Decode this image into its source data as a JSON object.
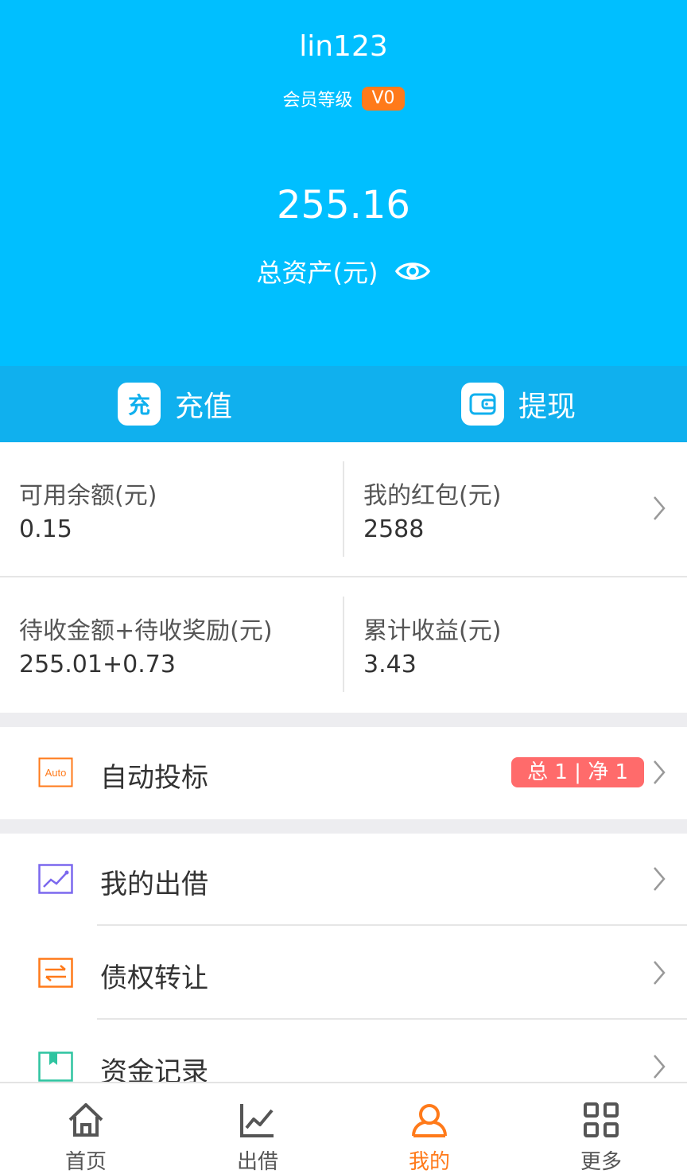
{
  "header": {
    "username": "lin123",
    "member_level_label": "会员等级",
    "member_level_badge": "V0",
    "total_assets": "255.16",
    "total_assets_label": "总资产(元)"
  },
  "actions": {
    "recharge_icon_text": "充",
    "recharge_label": "充值",
    "withdraw_label": "提现"
  },
  "stats": {
    "available_balance_label": "可用余额(元)",
    "available_balance_value": "0.15",
    "red_packet_label": "我的红包(元)",
    "red_packet_value": "2588",
    "pending_label": "待收金额+待收奖励(元)",
    "pending_value": "255.01+0.73",
    "cumulative_label": "累计收益(元)",
    "cumulative_value": "3.43"
  },
  "menu": {
    "auto_bid_icon_text": "Auto",
    "auto_bid_label": "自动投标",
    "auto_bid_badge": "总 1 | 净 1",
    "my_lending_label": "我的出借",
    "debt_transfer_label": "债权转让",
    "fund_records_label": "资金记录"
  },
  "nav": {
    "home": "首页",
    "lend": "出借",
    "mine": "我的",
    "more": "更多"
  },
  "colors": {
    "header_bg": "#00bfff",
    "action_bar_bg": "#10b0ee",
    "accent_orange": "#ff7a1a",
    "badge_red": "#ff6b6b"
  }
}
